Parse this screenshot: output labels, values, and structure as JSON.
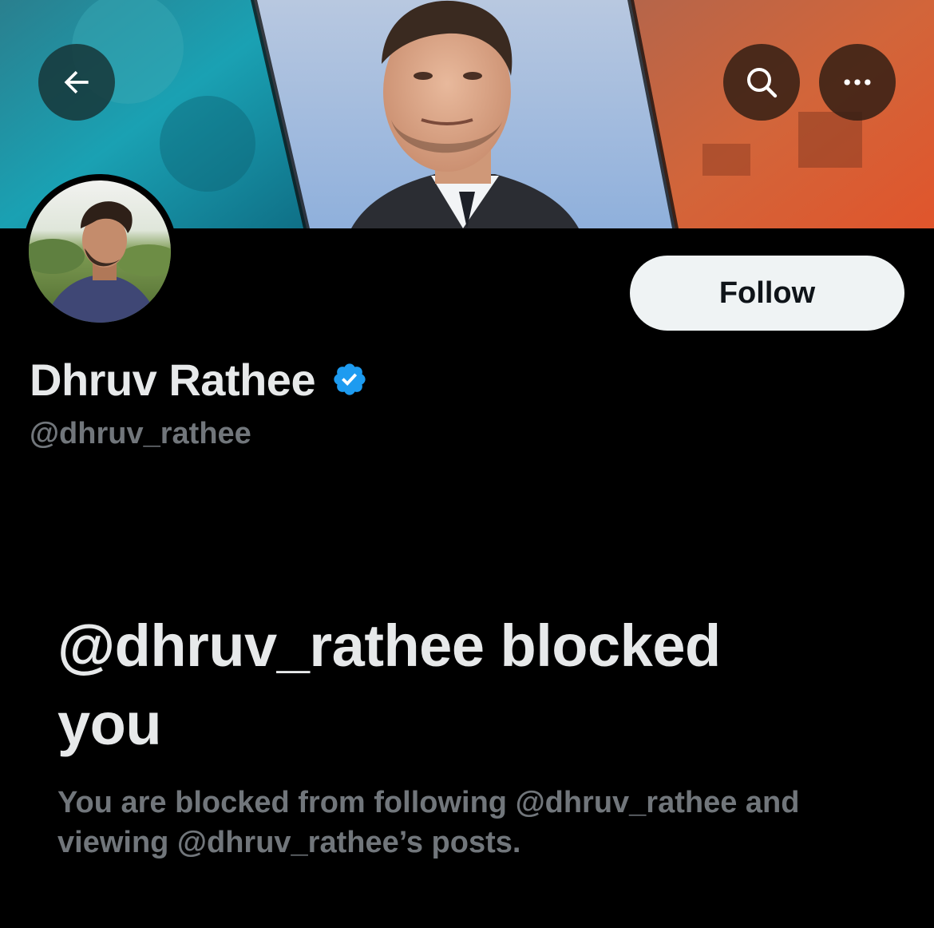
{
  "header": {
    "back_icon": "arrow-left-icon",
    "search_icon": "search-icon",
    "more_icon": "more-horizontal-icon"
  },
  "profile": {
    "display_name": "Dhruv Rathee",
    "handle": "@dhruv_rathee",
    "verified_icon": "verified-badge-icon",
    "follow_label": "Follow"
  },
  "blocked": {
    "title": "@dhruv_rathee blocked you",
    "description": "You are blocked from following @dhruv_rathee and viewing @dhruv_rathee’s posts."
  },
  "colors": {
    "background": "#000000",
    "primary_text": "#e7e9ea",
    "secondary_text": "#71767b",
    "verified_blue": "#1d9bf0",
    "follow_bg": "#eff3f4"
  }
}
